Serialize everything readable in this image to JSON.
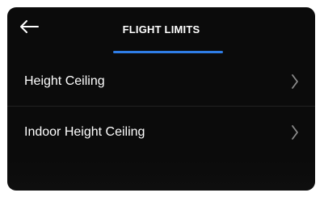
{
  "header": {
    "back_icon": "arrow-left-icon",
    "title": "FLIGHT LIMITS"
  },
  "menu": {
    "items": [
      {
        "label": "Height Ceiling",
        "icon": "chevron-right-icon"
      },
      {
        "label": "Indoor Height Ceiling",
        "icon": "chevron-right-icon"
      }
    ]
  },
  "colors": {
    "background": "#0b0b0b",
    "text": "#ffffff",
    "accent": "#2f7de6",
    "chevron": "#8a8a8a",
    "divider": "#222222"
  }
}
